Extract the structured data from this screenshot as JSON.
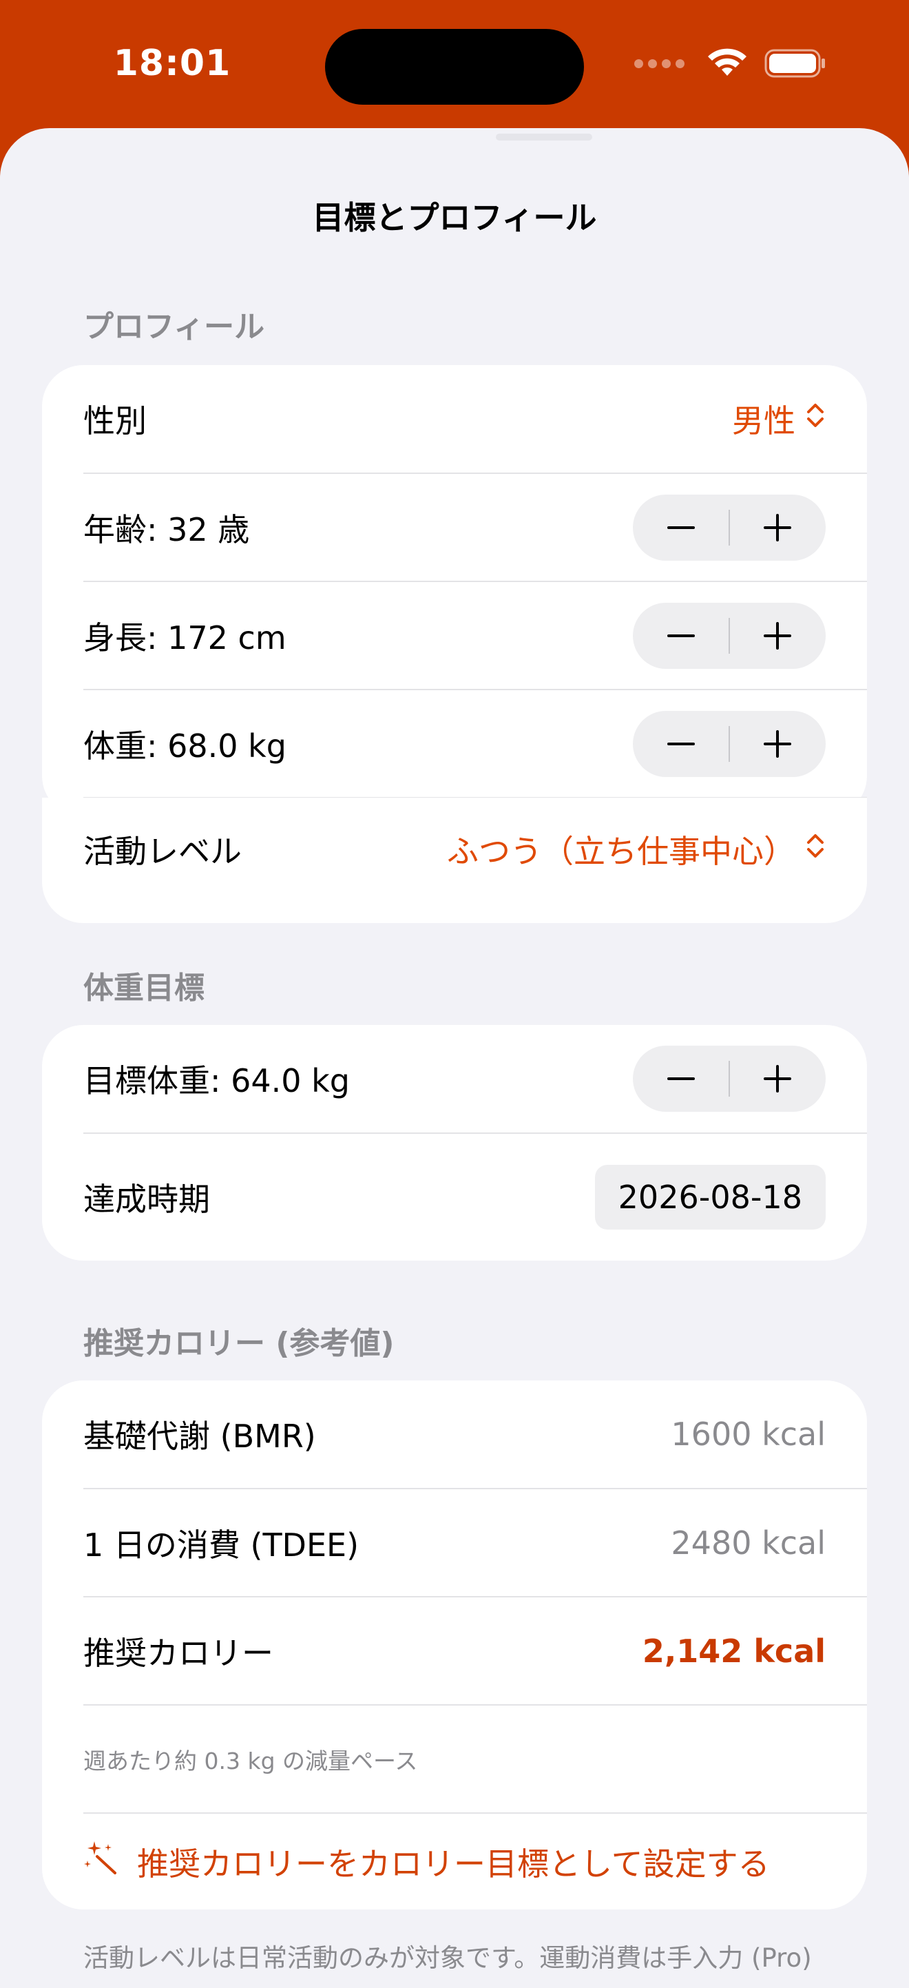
{
  "status_bar": {
    "time": "18:01"
  },
  "sheet": {
    "title": "目標とプロフィール"
  },
  "profile": {
    "header": "プロフィール",
    "sex": {
      "label": "性別",
      "value": "男性"
    },
    "age": {
      "label": "年齢: 32 歳"
    },
    "height": {
      "label": "身長: 172 cm"
    },
    "weight": {
      "label": "体重: 68.0 kg"
    },
    "activity": {
      "label": "活動レベル",
      "value": "ふつう（立ち仕事中心）"
    }
  },
  "weight_goal": {
    "header": "体重目標",
    "target": {
      "label": "目標体重: 64.0 kg"
    },
    "deadline": {
      "label": "達成時期",
      "value": "2026-08-18"
    }
  },
  "calories": {
    "header": "推奨カロリー (参考値)",
    "bmr": {
      "label": "基礎代謝 (BMR)",
      "value": "1600 kcal"
    },
    "tdee": {
      "label": "1 日の消費 (TDEE)",
      "value": "2480 kcal"
    },
    "recommended": {
      "label": "推奨カロリー",
      "value": "2,142 kcal"
    },
    "pace_note": "週あたり約 0.3 kg の減量ペース",
    "set_goal_action": "推奨カロリーをカロリー目標として設定する"
  },
  "footer_note": "活動レベルは日常活動のみが対象です。運動消費は手入力 (Pro)",
  "colors": {
    "accent": "#E04A05",
    "accent_dark": "#C93A00",
    "background": "#F2F2F7",
    "secondary_text": "#8A8A8E"
  },
  "icons": {
    "minus": "minus-icon",
    "plus": "plus-icon",
    "chevron_updown": "chevron-up-down-icon",
    "magic_wand": "magic-wand-icon"
  }
}
